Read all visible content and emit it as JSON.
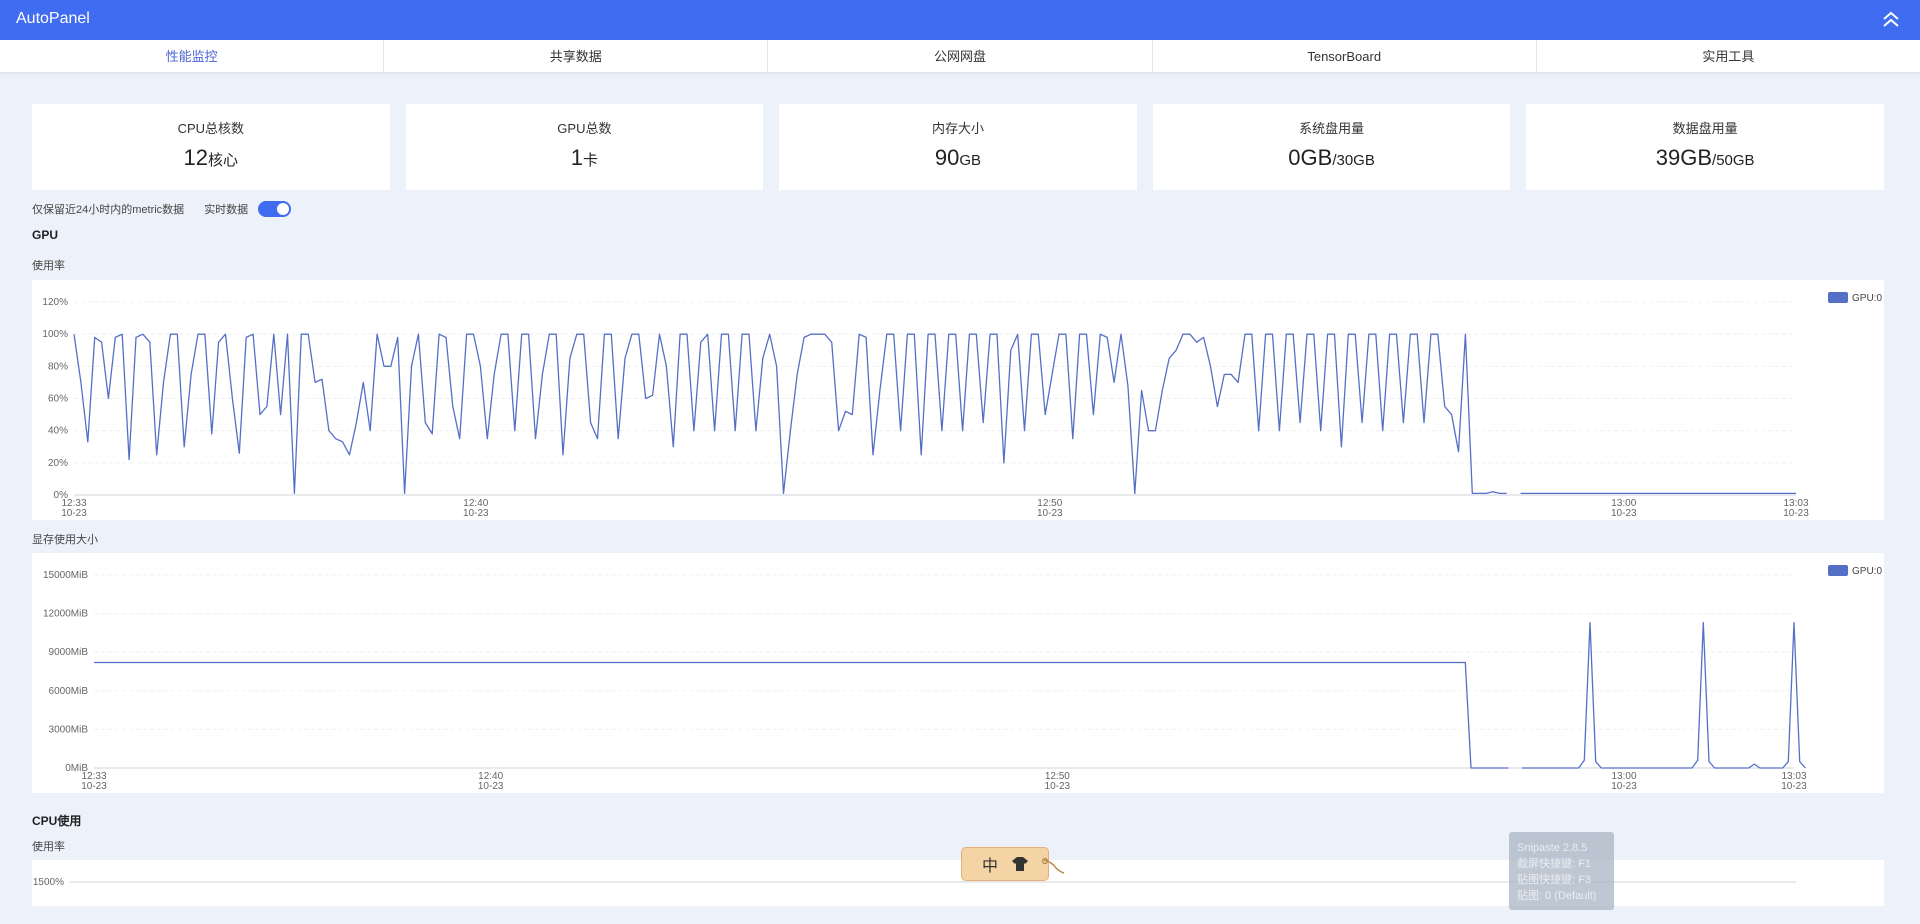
{
  "header": {
    "title": "AutoPanel",
    "collapse_icon": "double-chevron-up-icon"
  },
  "tabs": [
    {
      "label": "性能监控",
      "active": true
    },
    {
      "label": "共享数据",
      "active": false
    },
    {
      "label": "公网网盘",
      "active": false
    },
    {
      "label": "TensorBoard",
      "active": false
    },
    {
      "label": "实用工具",
      "active": false
    }
  ],
  "stats": [
    {
      "label": "CPU总核数",
      "value": "12",
      "unit": "核心"
    },
    {
      "label": "GPU总数",
      "value": "1",
      "unit": "卡"
    },
    {
      "label": "内存大小",
      "value": "90",
      "unit": "GB"
    },
    {
      "label": "系统盘用量",
      "value": "0GB",
      "unit": "/30GB"
    },
    {
      "label": "数据盘用量",
      "value": "39GB",
      "unit": "/50GB"
    }
  ],
  "options": {
    "retention_note": "仅保留近24小时内的metric数据",
    "realtime_label": "实时数据",
    "realtime_on": true
  },
  "gpu_section": {
    "title": "GPU",
    "usage_label": "使用率",
    "memory_label": "显存使用大小"
  },
  "cpu_section": {
    "title": "CPU使用",
    "usage_label": "使用率"
  },
  "colors": {
    "accent": "#3f6cf0",
    "line": "#5470c6"
  },
  "ime": {
    "char": "中",
    "icon": "shirt-icon"
  },
  "snipaste": {
    "lines": [
      "Snipaste 2.8.5",
      "截屏快捷键: F1",
      "贴图快捷键: F3",
      "贴图: 0 (Default)"
    ]
  },
  "chart_data": [
    {
      "type": "line",
      "name": "GPU使用率",
      "legend": [
        "GPU:0"
      ],
      "y_unit": "%",
      "yticks": [
        "0%",
        "20%",
        "40%",
        "60%",
        "80%",
        "100%",
        "120%"
      ],
      "ylim": [
        0,
        120
      ],
      "xticks": [
        [
          "12:33",
          "10-23"
        ],
        [
          "12:40",
          "10-23"
        ],
        [
          "12:50",
          "10-23"
        ],
        [
          "13:00",
          "10-23"
        ],
        [
          "13:03",
          "10-23"
        ]
      ],
      "x_range_min": [
        0,
        30
      ],
      "xtick_min": [
        0,
        7,
        17,
        27,
        30
      ],
      "segments": [
        [
          [
            0.0,
            100
          ],
          [
            0.12,
            70
          ],
          [
            0.24,
            33
          ],
          [
            0.36,
            98
          ],
          [
            0.48,
            95
          ],
          [
            0.6,
            60
          ],
          [
            0.72,
            98
          ],
          [
            0.84,
            100
          ],
          [
            0.96,
            22
          ],
          [
            1.08,
            98
          ],
          [
            1.2,
            100
          ],
          [
            1.32,
            95
          ],
          [
            1.44,
            25
          ],
          [
            1.56,
            70
          ],
          [
            1.68,
            100
          ],
          [
            1.8,
            100
          ],
          [
            1.92,
            30
          ],
          [
            2.04,
            75
          ],
          [
            2.16,
            100
          ],
          [
            2.28,
            100
          ],
          [
            2.4,
            38
          ],
          [
            2.52,
            95
          ],
          [
            2.64,
            100
          ],
          [
            2.76,
            60
          ],
          [
            2.88,
            26
          ],
          [
            3.0,
            98
          ],
          [
            3.12,
            100
          ],
          [
            3.24,
            50
          ],
          [
            3.36,
            55
          ],
          [
            3.48,
            100
          ],
          [
            3.6,
            50
          ],
          [
            3.72,
            100
          ],
          [
            3.84,
            1
          ],
          [
            3.96,
            100
          ],
          [
            4.08,
            100
          ],
          [
            4.2,
            70
          ],
          [
            4.32,
            72
          ],
          [
            4.44,
            40
          ],
          [
            4.56,
            35
          ],
          [
            4.68,
            33
          ],
          [
            4.8,
            25
          ],
          [
            4.92,
            45
          ],
          [
            5.04,
            70
          ],
          [
            5.16,
            40
          ],
          [
            5.28,
            100
          ],
          [
            5.4,
            80
          ],
          [
            5.52,
            80
          ],
          [
            5.64,
            98
          ],
          [
            5.76,
            1
          ],
          [
            5.88,
            80
          ],
          [
            6.0,
            100
          ],
          [
            6.12,
            45
          ],
          [
            6.24,
            38
          ],
          [
            6.36,
            100
          ],
          [
            6.48,
            98
          ],
          [
            6.6,
            55
          ],
          [
            6.72,
            35
          ],
          [
            6.84,
            100
          ],
          [
            6.96,
            100
          ],
          [
            7.08,
            80
          ],
          [
            7.2,
            35
          ],
          [
            7.32,
            75
          ],
          [
            7.44,
            100
          ],
          [
            7.56,
            100
          ],
          [
            7.68,
            40
          ],
          [
            7.8,
            100
          ],
          [
            7.92,
            100
          ],
          [
            8.04,
            35
          ],
          [
            8.16,
            75
          ],
          [
            8.28,
            100
          ],
          [
            8.4,
            100
          ],
          [
            8.52,
            25
          ],
          [
            8.64,
            85
          ],
          [
            8.76,
            100
          ],
          [
            8.88,
            100
          ],
          [
            9.0,
            45
          ],
          [
            9.12,
            35
          ],
          [
            9.24,
            100
          ],
          [
            9.36,
            100
          ],
          [
            9.48,
            35
          ],
          [
            9.6,
            85
          ],
          [
            9.72,
            100
          ],
          [
            9.84,
            100
          ],
          [
            9.96,
            60
          ],
          [
            10.08,
            62
          ],
          [
            10.2,
            100
          ],
          [
            10.32,
            80
          ],
          [
            10.44,
            30
          ],
          [
            10.56,
            100
          ],
          [
            10.68,
            100
          ],
          [
            10.8,
            40
          ],
          [
            10.92,
            95
          ],
          [
            11.04,
            100
          ],
          [
            11.16,
            40
          ],
          [
            11.28,
            100
          ],
          [
            11.4,
            100
          ],
          [
            11.52,
            40
          ],
          [
            11.64,
            100
          ],
          [
            11.76,
            100
          ],
          [
            11.88,
            40
          ],
          [
            12.0,
            85
          ],
          [
            12.12,
            100
          ],
          [
            12.24,
            80
          ],
          [
            12.36,
            1
          ],
          [
            12.48,
            40
          ],
          [
            12.6,
            75
          ],
          [
            12.72,
            98
          ],
          [
            12.84,
            100
          ],
          [
            12.96,
            100
          ],
          [
            13.08,
            100
          ],
          [
            13.2,
            95
          ],
          [
            13.32,
            40
          ],
          [
            13.44,
            52
          ],
          [
            13.56,
            50
          ],
          [
            13.68,
            100
          ],
          [
            13.8,
            98
          ],
          [
            13.92,
            25
          ],
          [
            14.04,
            65
          ],
          [
            14.16,
            100
          ],
          [
            14.28,
            100
          ],
          [
            14.4,
            40
          ],
          [
            14.52,
            100
          ],
          [
            14.64,
            100
          ],
          [
            14.76,
            25
          ],
          [
            14.88,
            100
          ],
          [
            15.0,
            100
          ],
          [
            15.12,
            40
          ],
          [
            15.24,
            100
          ],
          [
            15.36,
            100
          ],
          [
            15.48,
            40
          ],
          [
            15.6,
            100
          ],
          [
            15.72,
            100
          ],
          [
            15.84,
            45
          ],
          [
            15.96,
            100
          ],
          [
            16.08,
            100
          ],
          [
            16.2,
            20
          ],
          [
            16.32,
            90
          ],
          [
            16.44,
            100
          ],
          [
            16.56,
            40
          ],
          [
            16.68,
            100
          ],
          [
            16.8,
            100
          ],
          [
            16.92,
            50
          ],
          [
            17.04,
            75
          ],
          [
            17.16,
            100
          ],
          [
            17.28,
            100
          ],
          [
            17.4,
            35
          ],
          [
            17.52,
            100
          ],
          [
            17.64,
            100
          ],
          [
            17.76,
            50
          ],
          [
            17.88,
            100
          ],
          [
            18.0,
            98
          ],
          [
            18.12,
            70
          ],
          [
            18.24,
            100
          ],
          [
            18.36,
            68
          ],
          [
            18.48,
            1
          ],
          [
            18.6,
            65
          ],
          [
            18.72,
            40
          ],
          [
            18.84,
            40
          ],
          [
            18.96,
            65
          ],
          [
            19.08,
            85
          ],
          [
            19.2,
            90
          ],
          [
            19.32,
            100
          ],
          [
            19.44,
            100
          ],
          [
            19.56,
            95
          ],
          [
            19.68,
            98
          ],
          [
            19.8,
            80
          ],
          [
            19.92,
            55
          ],
          [
            20.04,
            75
          ],
          [
            20.16,
            75
          ],
          [
            20.28,
            70
          ],
          [
            20.4,
            100
          ],
          [
            20.52,
            100
          ],
          [
            20.64,
            40
          ],
          [
            20.76,
            100
          ],
          [
            20.88,
            100
          ],
          [
            21.0,
            40
          ],
          [
            21.12,
            100
          ],
          [
            21.24,
            100
          ],
          [
            21.36,
            45
          ],
          [
            21.48,
            100
          ],
          [
            21.6,
            100
          ],
          [
            21.72,
            40
          ],
          [
            21.84,
            100
          ],
          [
            21.96,
            100
          ],
          [
            22.08,
            30
          ],
          [
            22.2,
            100
          ],
          [
            22.32,
            100
          ],
          [
            22.44,
            45
          ],
          [
            22.56,
            100
          ],
          [
            22.68,
            100
          ],
          [
            22.8,
            40
          ],
          [
            22.92,
            100
          ],
          [
            23.04,
            100
          ],
          [
            23.16,
            45
          ],
          [
            23.28,
            100
          ],
          [
            23.4,
            100
          ],
          [
            23.52,
            45
          ],
          [
            23.64,
            100
          ],
          [
            23.76,
            100
          ],
          [
            23.88,
            55
          ],
          [
            24.0,
            50
          ],
          [
            24.12,
            27
          ],
          [
            24.24,
            100
          ],
          [
            24.36,
            1
          ],
          [
            24.48,
            1
          ],
          [
            24.6,
            1
          ],
          [
            24.72,
            2
          ],
          [
            24.84,
            1
          ],
          [
            24.96,
            1
          ]
        ],
        [
          [
            25.2,
            1
          ],
          [
            30.0,
            1
          ]
        ]
      ]
    },
    {
      "type": "line",
      "name": "显存使用大小",
      "legend": [
        "GPU:0"
      ],
      "y_unit": "MiB",
      "yticks": [
        "0MiB",
        "3000MiB",
        "6000MiB",
        "9000MiB",
        "12000MiB",
        "15000MiB"
      ],
      "ylim": [
        0,
        15000
      ],
      "xticks": [
        [
          "12:33",
          "10-23"
        ],
        [
          "12:40",
          "10-23"
        ],
        [
          "12:50",
          "10-23"
        ],
        [
          "13:00",
          "10-23"
        ],
        [
          "13:03",
          "10-23"
        ]
      ],
      "x_range_min": [
        0,
        30
      ],
      "xtick_min": [
        0,
        7,
        17,
        27,
        30
      ],
      "segments": [
        [
          [
            0.0,
            8200
          ],
          [
            24.2,
            8200
          ],
          [
            24.3,
            0
          ],
          [
            24.96,
            0
          ]
        ],
        [
          [
            25.2,
            0
          ],
          [
            26.2,
            0
          ],
          [
            26.3,
            600
          ],
          [
            26.4,
            11300
          ],
          [
            26.5,
            500
          ],
          [
            26.6,
            0
          ],
          [
            28.2,
            0
          ],
          [
            28.3,
            600
          ],
          [
            28.4,
            11300
          ],
          [
            28.5,
            500
          ],
          [
            28.6,
            0
          ],
          [
            29.2,
            0
          ],
          [
            29.3,
            300
          ],
          [
            29.4,
            0
          ],
          [
            29.8,
            0
          ],
          [
            29.9,
            500
          ],
          [
            30.0,
            11300
          ],
          [
            30.1,
            500
          ],
          [
            30.2,
            0
          ]
        ]
      ]
    },
    {
      "type": "line",
      "name": "CPU使用率",
      "yticks": [
        "1500%"
      ],
      "ylim": [
        0,
        1500
      ]
    }
  ]
}
